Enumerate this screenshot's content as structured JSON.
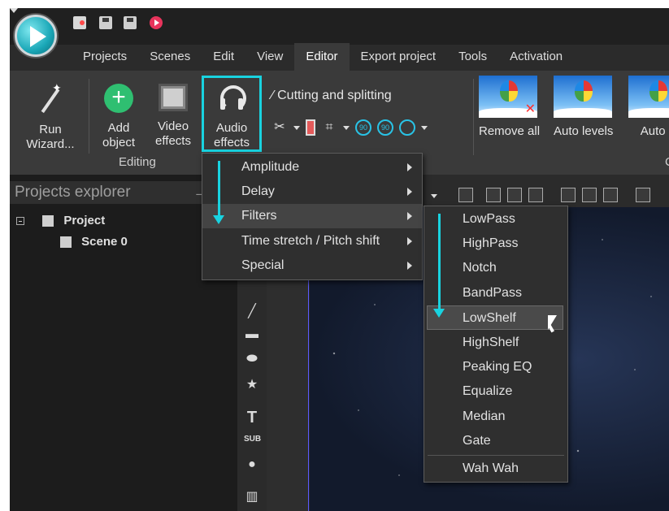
{
  "menu_tabs": [
    "Projects",
    "Scenes",
    "Edit",
    "View",
    "Editor",
    "Export project",
    "Tools",
    "Activation"
  ],
  "ribbon": {
    "run_wizard": {
      "line1": "Run",
      "line2": "Wizard..."
    },
    "add_object": {
      "line1": "Add",
      "line2": "object"
    },
    "video_effects": {
      "line1": "Video",
      "line2": "effects"
    },
    "audio_effects": {
      "line1": "Audio",
      "line2": "effects"
    },
    "group_editing": "Editing",
    "cutting_label": "Cutting and splitting",
    "thumbs": [
      "Remove all",
      "Auto levels",
      "Auto c"
    ],
    "group_right": "C"
  },
  "panel": {
    "title": "Projects explorer",
    "project": "Project",
    "scene": "Scene 0"
  },
  "audio_menu": [
    "Amplitude",
    "Delay",
    "Filters",
    "Time stretch / Pitch shift",
    "Special"
  ],
  "filters_menu": [
    "LowPass",
    "HighPass",
    "Notch",
    "BandPass",
    "LowShelf",
    "HighShelf",
    "Peaking EQ",
    "Equalize",
    "Median",
    "Gate",
    "Wah Wah"
  ],
  "side_tools_text": {
    "text_tool": "T",
    "sub_tool": "SUB"
  },
  "colors": {
    "highlight": "#19d3e0",
    "background": "#2b2b2b",
    "menu": "#2f2f2f"
  }
}
